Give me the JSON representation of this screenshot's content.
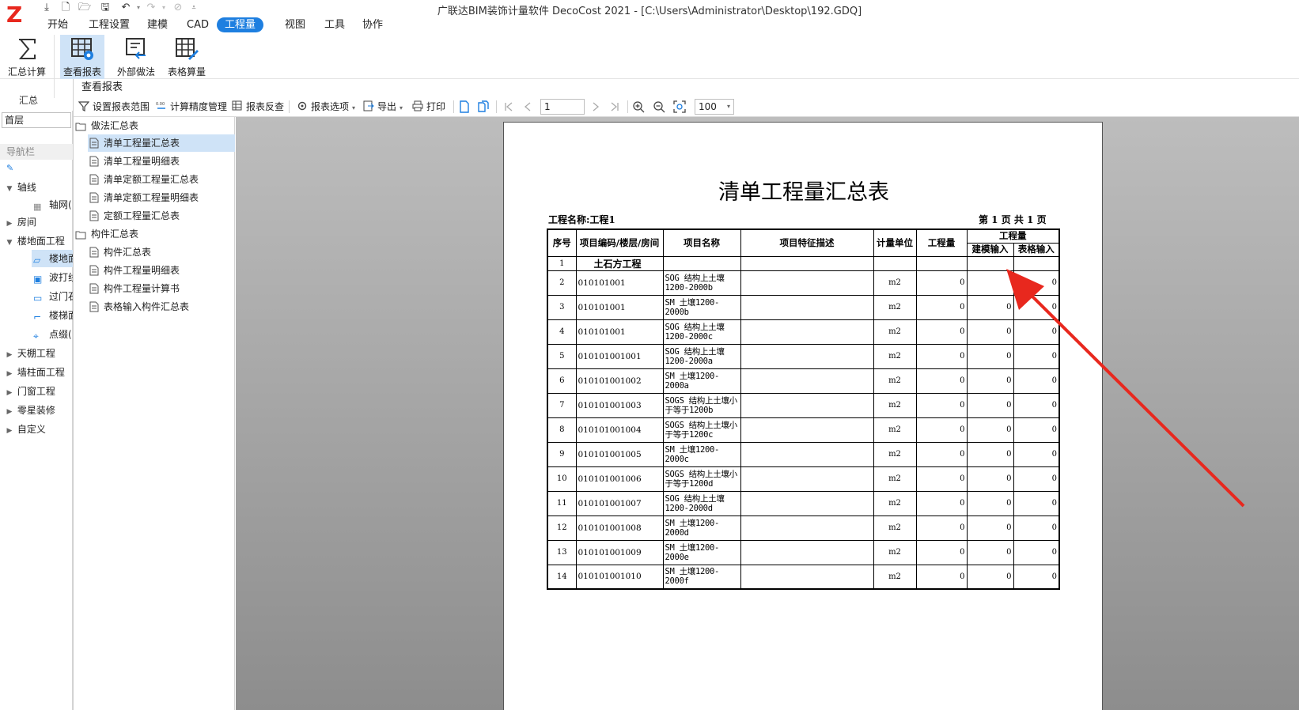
{
  "app": {
    "title": "广联达BIM装饰计量软件 DecoCost 2021 - [C:\\Users\\Administrator\\Desktop\\192.GDQ]",
    "logo_letter": "Z"
  },
  "menu": {
    "items": [
      {
        "label": "开始"
      },
      {
        "label": "工程设置"
      },
      {
        "label": "建模"
      },
      {
        "label": "CAD"
      },
      {
        "label": "工程量",
        "active": true
      },
      {
        "label": "视图"
      },
      {
        "label": "工具"
      },
      {
        "label": "协作"
      }
    ]
  },
  "ribbon": {
    "buttons": [
      {
        "label": "汇总计算"
      },
      {
        "label": "查看报表"
      },
      {
        "label": "外部做法"
      },
      {
        "label": "表格算量"
      }
    ],
    "group_label": "汇总"
  },
  "left_panel": {
    "floor": "首层",
    "nav_header": "导航栏",
    "items": [
      {
        "label": "轴线",
        "caret": "▾"
      },
      {
        "label": "轴网(",
        "sub": true
      },
      {
        "label": "房间",
        "caret": "▸"
      },
      {
        "label": "楼地面工程",
        "caret": "▾"
      },
      {
        "label": "楼地面",
        "sub": true
      },
      {
        "label": "波打线",
        "sub": true
      },
      {
        "label": "过门石",
        "sub": true
      },
      {
        "label": "楼梯面",
        "sub": true
      },
      {
        "label": "点缀(",
        "sub": true
      },
      {
        "label": "天棚工程",
        "caret": "▸"
      },
      {
        "label": "墙柱面工程",
        "caret": "▸"
      },
      {
        "label": "门窗工程",
        "caret": "▸"
      },
      {
        "label": "零星装修",
        "caret": "▸"
      },
      {
        "label": "自定义",
        "caret": "▸"
      }
    ]
  },
  "dialog": {
    "title": "查看报表",
    "toolbar": {
      "set_range": "设置报表范围",
      "precision": "计算精度管理",
      "reverse_check": "报表反查",
      "options": "报表选项",
      "export": "导出",
      "print": "打印",
      "page": "1",
      "zoom": "100"
    },
    "tree": {
      "groups": [
        {
          "label": "做法汇总表",
          "items": [
            "清单工程量汇总表",
            "清单工程量明细表",
            "清单定额工程量汇总表",
            "清单定额工程量明细表",
            "定额工程量汇总表"
          ]
        },
        {
          "label": "构件汇总表",
          "items": [
            "构件汇总表",
            "构件工程量明细表",
            "构件工程量计算书",
            "表格输入构件汇总表"
          ]
        }
      ],
      "selected": "清单工程量汇总表"
    }
  },
  "report": {
    "title": "清单工程量汇总表",
    "project": "工程名称:工程1",
    "page_info": "第 1 页 共 1 页",
    "headers": {
      "seq": "序号",
      "code": "项目编码/楼层/房间",
      "name": "项目名称",
      "feature": "项目特征描述",
      "unit": "计量单位",
      "qty": "工程量",
      "qty_group": "工程量",
      "model_input": "建模输入",
      "table_input": "表格输入"
    },
    "section_row": {
      "seq": "1",
      "label": "土石方工程"
    },
    "rows": [
      {
        "seq": "2",
        "code": "010101001",
        "name": "SOG 结构上土壤1200-2000b",
        "unit": "m2",
        "qty": "0",
        "model": "",
        "table": "0"
      },
      {
        "seq": "3",
        "code": "010101001",
        "name": "SM 土壤1200-2000b",
        "unit": "m2",
        "qty": "0",
        "model": "0",
        "table": "0"
      },
      {
        "seq": "4",
        "code": "010101001",
        "name": "SOG 结构上土壤1200-2000c",
        "unit": "m2",
        "qty": "0",
        "model": "0",
        "table": "0"
      },
      {
        "seq": "5",
        "code": "010101001001",
        "name": "SOG 结构上土壤1200-2000a",
        "unit": "m2",
        "qty": "0",
        "model": "0",
        "table": "0"
      },
      {
        "seq": "6",
        "code": "010101001002",
        "name": "SM 土壤1200-2000a",
        "unit": "m2",
        "qty": "0",
        "model": "0",
        "table": "0"
      },
      {
        "seq": "7",
        "code": "010101001003",
        "name": "SOGS 结构上土壤小于等于1200b",
        "unit": "m2",
        "qty": "0",
        "model": "0",
        "table": "0"
      },
      {
        "seq": "8",
        "code": "010101001004",
        "name": "SOGS 结构上土壤小于等于1200c",
        "unit": "m2",
        "qty": "0",
        "model": "0",
        "table": "0"
      },
      {
        "seq": "9",
        "code": "010101001005",
        "name": "SM 土壤1200-2000c",
        "unit": "m2",
        "qty": "0",
        "model": "0",
        "table": "0"
      },
      {
        "seq": "10",
        "code": "010101001006",
        "name": "SOGS 结构上土壤小于等于1200d",
        "unit": "m2",
        "qty": "0",
        "model": "0",
        "table": "0"
      },
      {
        "seq": "11",
        "code": "010101001007",
        "name": "SOG 结构上土壤1200-2000d",
        "unit": "m2",
        "qty": "0",
        "model": "0",
        "table": "0"
      },
      {
        "seq": "12",
        "code": "010101001008",
        "name": "SM 土壤1200-2000d",
        "unit": "m2",
        "qty": "0",
        "model": "0",
        "table": "0"
      },
      {
        "seq": "13",
        "code": "010101001009",
        "name": "SM 土壤1200-2000e",
        "unit": "m2",
        "qty": "0",
        "model": "0",
        "table": "0"
      },
      {
        "seq": "14",
        "code": "010101001010",
        "name": "SM 土壤1200-2000f",
        "unit": "m2",
        "qty": "0",
        "model": "0",
        "table": "0"
      }
    ]
  },
  "colors": {
    "accent": "#1e7fe0",
    "selection": "#cfe3f7",
    "arrow": "#e8281e"
  }
}
